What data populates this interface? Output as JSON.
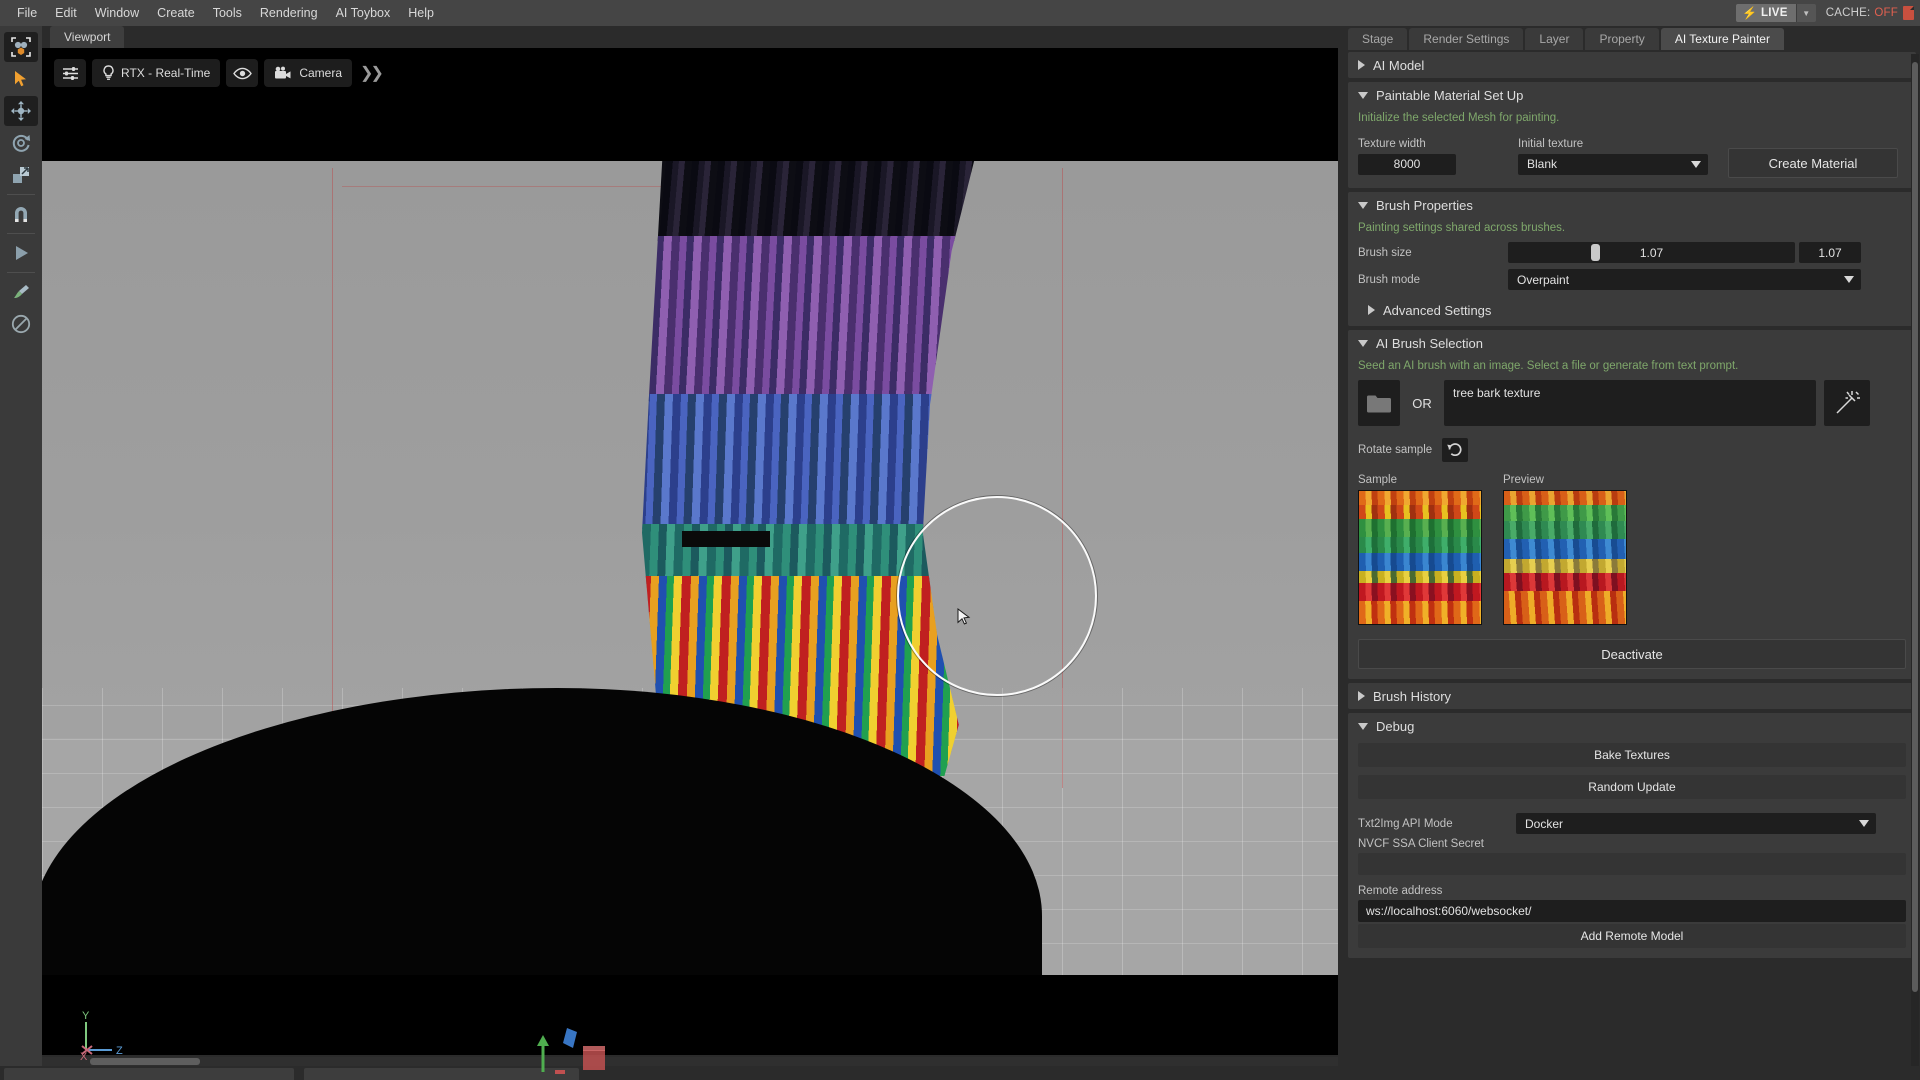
{
  "app": {
    "menu": [
      "File",
      "Edit",
      "Window",
      "Create",
      "Tools",
      "Rendering",
      "AI Toybox",
      "Help"
    ],
    "status": {
      "live_label": "LIVE",
      "cache_label": "CACHE:",
      "cache_value": "OFF",
      "accent_yellow": "#ffe000",
      "accent_red": "#e06050"
    }
  },
  "left_toolbar": {
    "items": [
      {
        "name": "select-objects-icon",
        "label": "Select"
      },
      {
        "name": "cursor-arrow-icon",
        "label": "Pick"
      },
      {
        "name": "move-tool-icon",
        "label": "Move"
      },
      {
        "name": "rotate-tool-icon",
        "label": "Rotate"
      },
      {
        "name": "scale-tool-icon",
        "label": "Scale"
      },
      {
        "name": "snap-magnet-icon",
        "label": "Snap"
      },
      {
        "name": "play-icon",
        "label": "Play"
      },
      {
        "name": "paint-brush-icon",
        "label": "Brush"
      },
      {
        "name": "disable-icon",
        "label": "Disable"
      }
    ]
  },
  "viewport": {
    "tab_label": "Viewport",
    "toolbar": {
      "settings_icon": "sliders-icon",
      "render_mode": "RTX - Real-Time",
      "render_mode_icon": "lightbulb-icon",
      "visibility_icon": "eye-icon",
      "camera_label": "Camera",
      "camera_icon": "camera-icon",
      "expand_icon": "chevron-double-right-icon"
    },
    "axis_gizmo": {
      "x": "X",
      "y": "Y",
      "z": "Z",
      "x_color": "#c86a7a",
      "y_color": "#7fc87f",
      "z_color": "#5a9bd5"
    }
  },
  "right_panel": {
    "tabs": [
      {
        "label": "Stage",
        "active": false
      },
      {
        "label": "Render Settings",
        "active": false
      },
      {
        "label": "Layer",
        "active": false
      },
      {
        "label": "Property",
        "active": false
      },
      {
        "label": "AI Texture Painter",
        "active": true
      }
    ],
    "ai_model": {
      "title": "AI Model",
      "expanded": false
    },
    "paintable_material": {
      "title": "Paintable Material Set Up",
      "hint": "Initialize the selected Mesh for painting.",
      "texture_width_label": "Texture width",
      "texture_width_value": "8000",
      "initial_texture_label": "Initial texture",
      "initial_texture_value": "Blank",
      "create_button": "Create Material"
    },
    "brush_properties": {
      "title": "Brush Properties",
      "hint": "Painting settings shared across brushes.",
      "brush_size_label": "Brush size",
      "brush_size_value": "1.07",
      "brush_size_field": "1.07",
      "brush_size_percent": 30,
      "brush_mode_label": "Brush mode",
      "brush_mode_value": "Overpaint",
      "advanced_settings": "Advanced Settings"
    },
    "ai_brush_selection": {
      "title": "AI Brush Selection",
      "hint": "Seed an AI brush with an image. Select a file or generate from text prompt.",
      "folder_icon": "folder-icon",
      "or_label": "OR",
      "prompt_value": "tree bark texture",
      "generate_icon": "magic-wand-icon",
      "rotate_label": "Rotate sample",
      "rotate_icon": "rotate-ccw-icon",
      "sample_label": "Sample",
      "preview_label": "Preview",
      "deactivate_button": "Deactivate"
    },
    "brush_history": {
      "title": "Brush History",
      "expanded": false
    },
    "debug": {
      "title": "Debug",
      "bake_button": "Bake Textures",
      "random_button": "Random Update",
      "txt2img_label": "Txt2Img API Mode",
      "txt2img_value": "Docker",
      "nvcf_label": "NVCF SSA Client Secret",
      "nvcf_value": "",
      "remote_label": "Remote address",
      "remote_value": "ws://localhost:6060/websocket/",
      "add_remote_button": "Add Remote Model"
    }
  }
}
